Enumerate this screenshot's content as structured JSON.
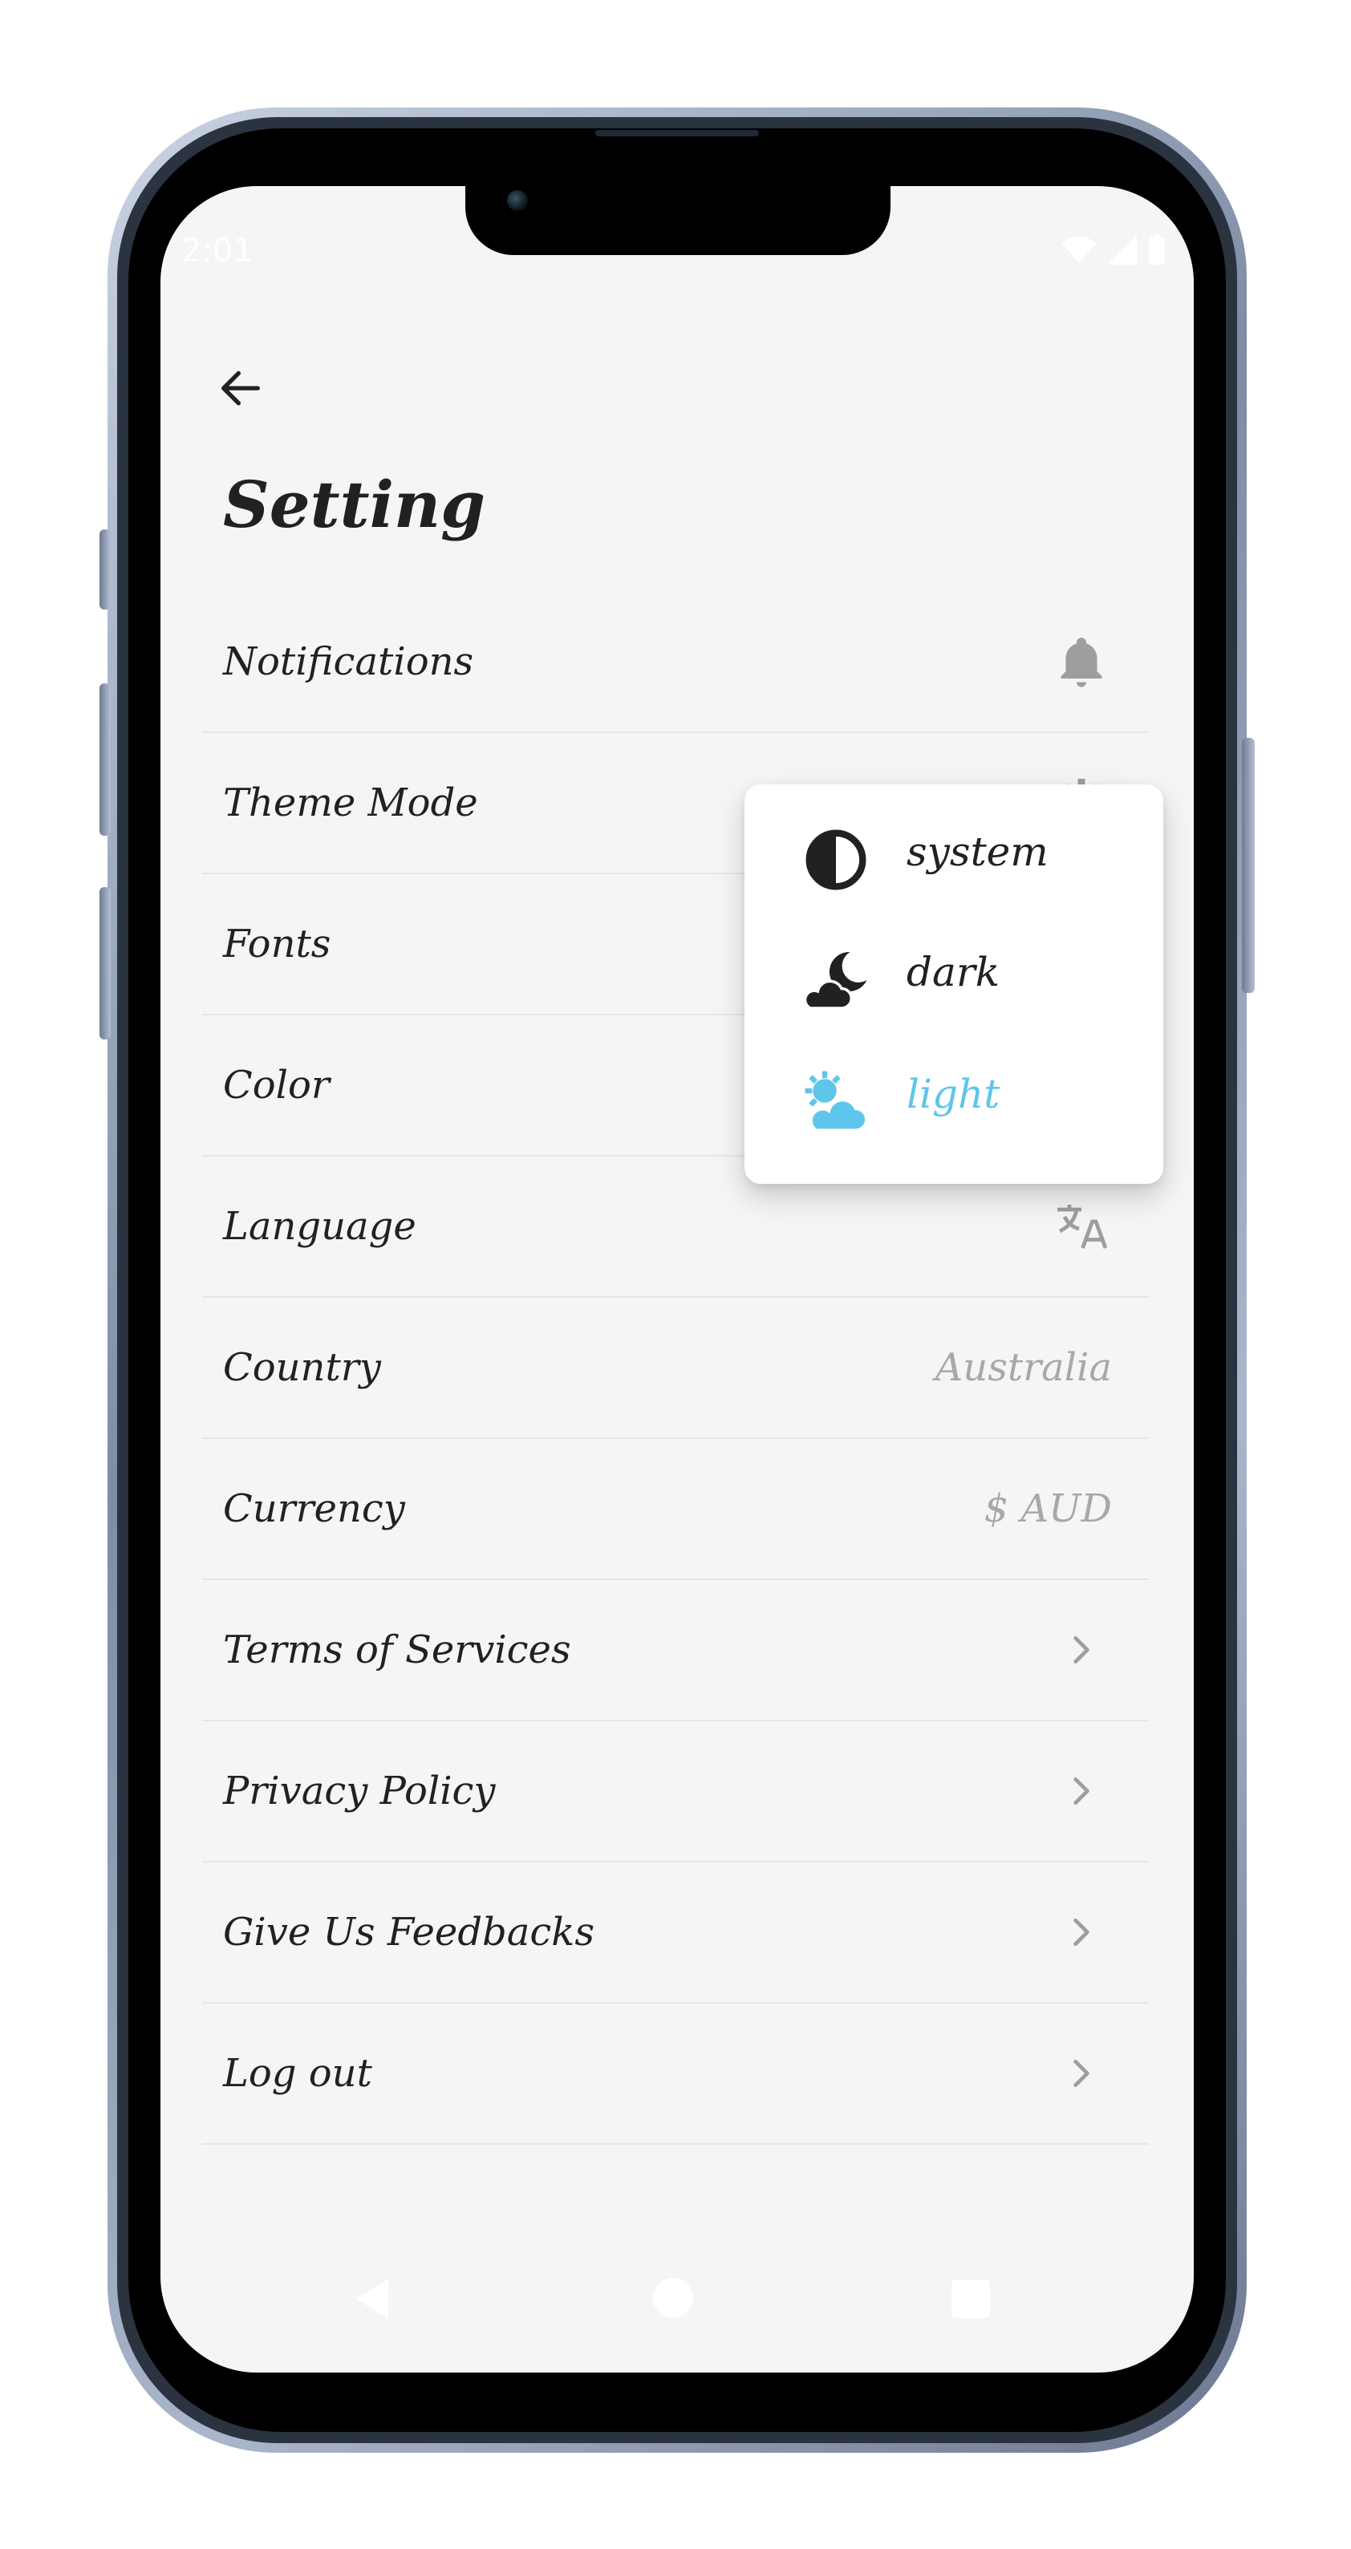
{
  "status_bar": {
    "time": "2:01"
  },
  "page": {
    "title": "Setting"
  },
  "rows": [
    {
      "label": "Notifications",
      "icon": "bell-icon"
    },
    {
      "label": "Theme Mode",
      "icon": "gear-icon"
    },
    {
      "label": "Fonts",
      "icon": "font-icon"
    },
    {
      "label": "Color",
      "icon": "palette-icon"
    },
    {
      "label": "Language",
      "icon": "translate-icon"
    },
    {
      "label": "Country",
      "value": "Australia"
    },
    {
      "label": "Currency",
      "value": "$ AUD"
    },
    {
      "label": "Terms of Services",
      "icon": "chevron-right-icon"
    },
    {
      "label": "Privacy Policy",
      "icon": "chevron-right-icon"
    },
    {
      "label": "Give Us Feedbacks",
      "icon": "chevron-right-icon"
    },
    {
      "label": "Log out",
      "icon": "chevron-right-icon"
    }
  ],
  "theme_menu": {
    "items": [
      {
        "label": "system",
        "icon": "half-circle-icon"
      },
      {
        "label": "dark",
        "icon": "moon-cloud-icon"
      },
      {
        "label": "light",
        "icon": "sun-cloud-icon",
        "selected": true
      }
    ],
    "selected_color": "#5ec6ea"
  },
  "colors": {
    "text": "#212121",
    "muted": "#a8a8a8",
    "background": "#f5f5f5"
  }
}
